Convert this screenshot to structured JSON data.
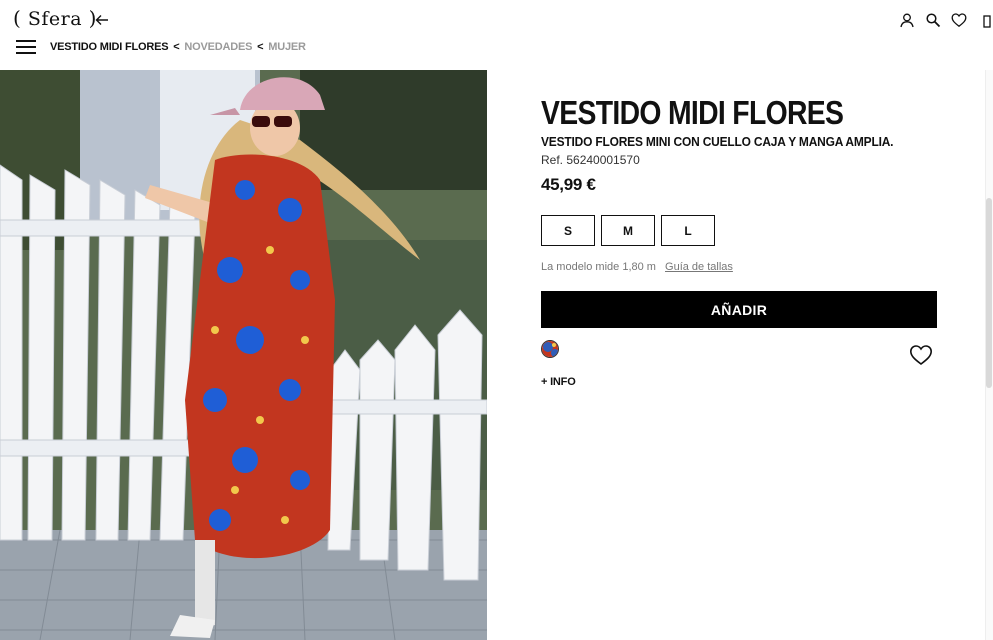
{
  "header": {
    "logo_open": "(",
    "logo_text": "Sfera",
    "logo_close": ")",
    "icons": [
      "back-arrow-icon",
      "menu-icon",
      "user-icon",
      "search-icon",
      "heart-icon",
      "bag-icon"
    ]
  },
  "breadcrumb": {
    "current": "VESTIDO MIDI FLORES",
    "sep1": "<",
    "link1": "NOVEDADES",
    "sep2": "<",
    "link2": "MUJER"
  },
  "product": {
    "title": "VESTIDO MIDI FLORES",
    "subtitle": "VESTIDO FLORES MINI CON CUELLO CAJA Y MANGA AMPLIA.",
    "ref": "Ref. 56240001570",
    "price": "45,99 €",
    "sizes": [
      "S",
      "M",
      "L"
    ],
    "model_text": "La modelo mide 1,80 m",
    "size_guide": "Guía de tallas",
    "add_button": "AÑADIR",
    "more_info": "+ INFO",
    "swatch_color": "#2f5db8"
  },
  "colors": {
    "accent": "#000000",
    "breadcrumb_link": "#9a9a9a",
    "muted_text": "#777777"
  }
}
